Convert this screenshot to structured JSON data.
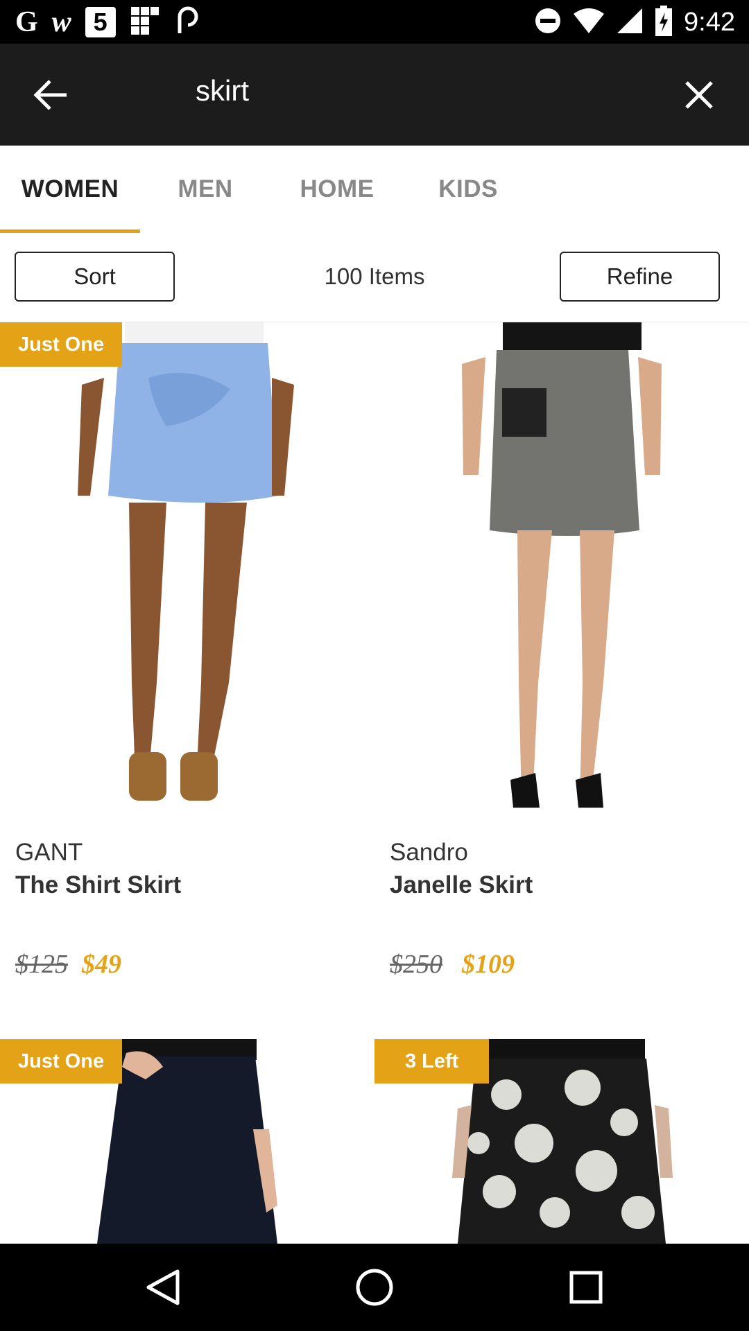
{
  "status_bar": {
    "left_icons": [
      "google-icon",
      "w-app-icon",
      "html5-icon",
      "grid-app-icon",
      "link-app-icon"
    ],
    "right_icons": [
      "do-not-disturb-icon",
      "wifi-icon",
      "signal-icon",
      "battery-charging-icon"
    ],
    "time": "9:42"
  },
  "search": {
    "query": "skirt"
  },
  "tabs": [
    {
      "label": "WOMEN",
      "active": true
    },
    {
      "label": "MEN",
      "active": false
    },
    {
      "label": "HOME",
      "active": false
    },
    {
      "label": "KIDS",
      "active": false
    }
  ],
  "toolbar": {
    "sort_label": "Sort",
    "item_count": "100 Items",
    "refine_label": "Refine"
  },
  "products": [
    {
      "badge": "Just One",
      "brand": "GANT",
      "name": "The Shirt Skirt",
      "price_original": "$125",
      "price_sale": "$49",
      "skirt_color": "#8fb3e6"
    },
    {
      "badge": "",
      "brand": "Sandro",
      "name": "Janelle Skirt",
      "price_original": "$250",
      "price_sale": "$109",
      "skirt_color": "#6f6f6c"
    },
    {
      "badge": "Just One",
      "brand": "",
      "name": "",
      "price_original": "",
      "price_sale": "",
      "skirt_color": "#141a2a"
    },
    {
      "badge": "3 Left",
      "brand": "",
      "name": "",
      "price_original": "",
      "price_sale": "",
      "skirt_color": "#1b1b1b"
    }
  ],
  "colors": {
    "accent": "#e4a316",
    "header_bg": "#1c1c1c",
    "status_bg": "#000000"
  },
  "nav_bar": {
    "icons": [
      "back-triangle-icon",
      "home-circle-icon",
      "recents-square-icon"
    ]
  }
}
